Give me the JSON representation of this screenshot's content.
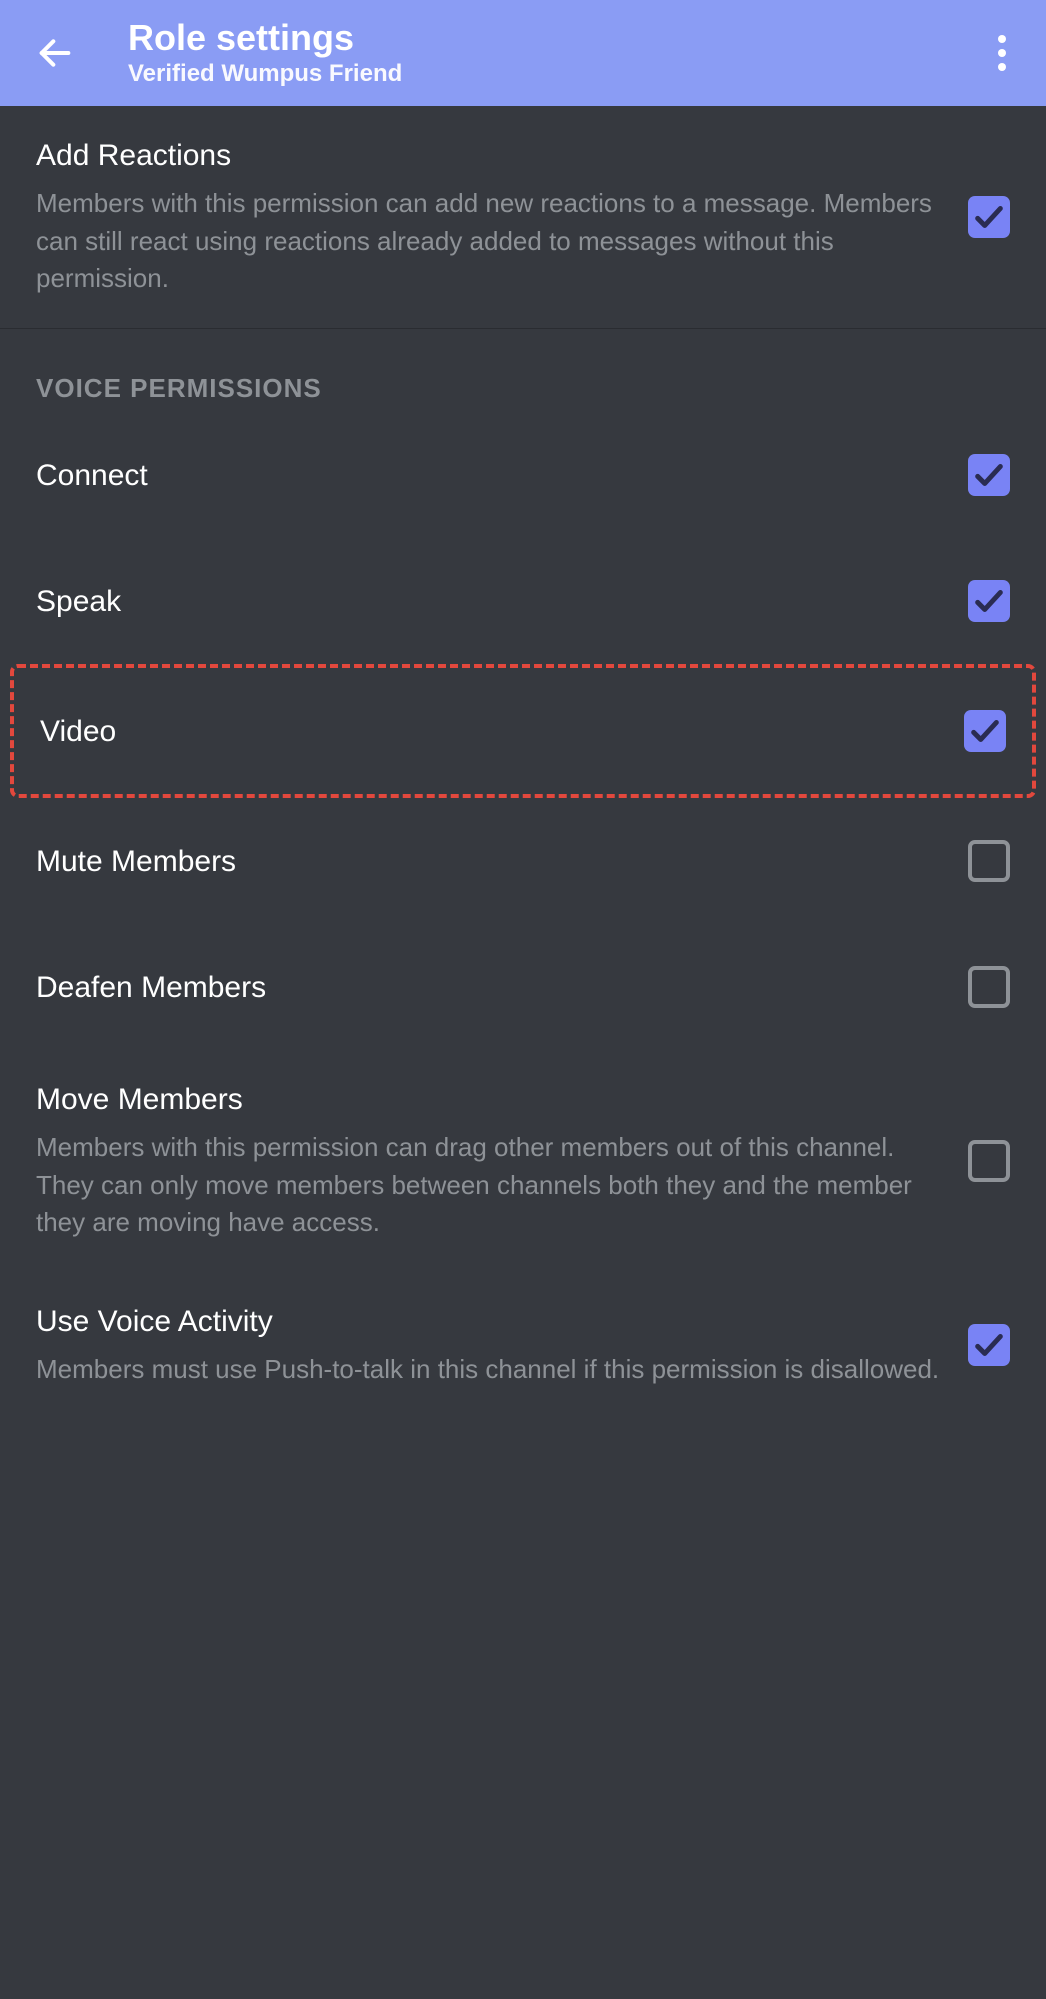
{
  "header": {
    "title": "Role settings",
    "subtitle": "Verified Wumpus Friend"
  },
  "sections": {
    "addReactions": {
      "title": "Add Reactions",
      "desc": "Members with this permission can add new reactions to a message. Members can still react using reactions already added to messages without this permission.",
      "checked": true
    },
    "voiceHeader": "VOICE PERMISSIONS",
    "connect": {
      "title": "Connect",
      "checked": true
    },
    "speak": {
      "title": "Speak",
      "checked": true
    },
    "video": {
      "title": "Video",
      "checked": true
    },
    "muteMembers": {
      "title": "Mute Members",
      "checked": false
    },
    "deafenMembers": {
      "title": "Deafen Members",
      "checked": false
    },
    "moveMembers": {
      "title": "Move Members",
      "desc": "Members with this permission can drag other members out of this channel. They can only move members between channels both they and the member they are moving have access.",
      "checked": false
    },
    "useVoiceActivity": {
      "title": "Use Voice Activity",
      "desc": "Members must use Push-to-talk in this channel if this permission is disallowed.",
      "checked": true
    }
  }
}
